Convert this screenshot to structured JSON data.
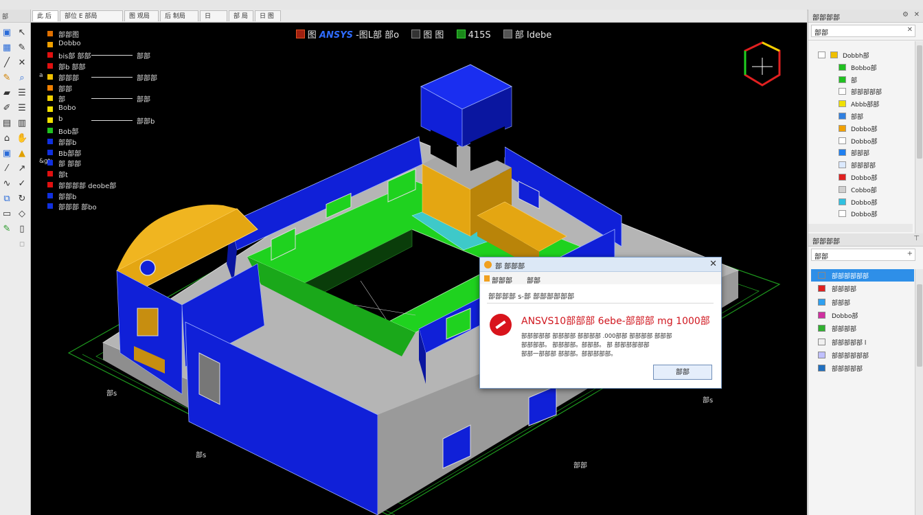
{
  "viewport_tabs": [
    "此 后",
    "部位 E 部局",
    "图 观局",
    "后 制局",
    "日",
    "部 局",
    "日 图"
  ],
  "header": {
    "prefix": "图 ",
    "brand": "ANSYS",
    "title": " -图L部 部o",
    "item1": "图 图",
    "item2": "415S",
    "item3": "部 Idebe"
  },
  "legend": [
    {
      "mark": "",
      "text": "部部图",
      "color": "#e07000"
    },
    {
      "mark": "",
      "text": "Dobbo",
      "color": "#f0a000"
    },
    {
      "mark": "",
      "text": "bis部 部部",
      "color": "#e01010",
      "trail": "部部"
    },
    {
      "mark": "",
      "text": "部b 部部",
      "color": "#e01010"
    },
    {
      "mark": "a",
      "text": "部部部",
      "color": "#f0c000",
      "trail": "部部部"
    },
    {
      "mark": "",
      "text": "部部",
      "color": "#f08000"
    },
    {
      "mark": "",
      "text": "部",
      "color": "#f0d000",
      "trail": "部部"
    },
    {
      "mark": "",
      "text": "Bobo",
      "color": "#f0e000"
    },
    {
      "mark": "",
      "text": "b",
      "color": "#f0e000",
      "trail": "部部b"
    },
    {
      "mark": "",
      "text": "Bob部",
      "color": "#20c020"
    },
    {
      "mark": "",
      "text": "部部b",
      "color": "#1030e0"
    },
    {
      "mark": "",
      "text": "Bb部部",
      "color": "#1030e0"
    },
    {
      "mark": "&gt;",
      "text": "部 部部",
      "color": "#1030e0"
    },
    {
      "mark": "",
      "text": "部t",
      "color": "#e01010"
    },
    {
      "mark": "",
      "text": "部部部部 deobe部",
      "color": "#e01010"
    },
    {
      "mark": "",
      "text": "部部b",
      "color": "#1030e0"
    },
    {
      "mark": "",
      "text": "部部部 部bo",
      "color": "#1030e0"
    }
  ],
  "dims": {
    "a": "部s",
    "b": "部s",
    "c": "部部",
    "d": "部s"
  },
  "dialog": {
    "title": "部 部部部",
    "menu1": "部部部",
    "menu2": "部部",
    "sub": "部部部部 s-部 部部部部部部",
    "heading": "ANSVS10部部部 6ebe-部部部 mg 1000部",
    "body1": "部部部部部 部部部部 部部部部 .000部部 部部部部 部部部",
    "body2": "部部部部。 部部部部。部部部。 部 部部部部部部",
    "body3": "部部一部部部 部部部。部部部部部。",
    "ok": "部部"
  },
  "right_panel": {
    "header1": "部部部部",
    "search1": "部部",
    "tree": [
      {
        "label": "Dobbh部",
        "color": "#f0c000"
      },
      {
        "label": "Bobbo部",
        "color": "#20c020"
      },
      {
        "label": "部",
        "color": "#20c020"
      },
      {
        "label": "部部部部部",
        "color": "#ffffff"
      },
      {
        "label": "Abbb部部",
        "color": "#f0e000"
      },
      {
        "label": "部部",
        "color": "#3080e0"
      },
      {
        "label": "Dobbo部",
        "color": "#f0a000"
      },
      {
        "label": "Dobbo部",
        "color": "#ffffff"
      },
      {
        "label": "部部部",
        "color": "#2080f0"
      },
      {
        "label": "部部部部",
        "color": "#dbe9ff"
      },
      {
        "label": "Dobbo部",
        "color": "#e02020"
      },
      {
        "label": "Cobbo部",
        "color": "#d0d0d0"
      },
      {
        "label": "Dobbo部",
        "color": "#30c0e0"
      },
      {
        "label": "Dobbo部",
        "color": "#ffffff"
      }
    ],
    "header2": "部部部部",
    "search2": "部部",
    "list": [
      {
        "label": "部部部部部部",
        "color": "#2e8fe8",
        "selected": true
      },
      {
        "label": "部部部部",
        "color": "#e02020"
      },
      {
        "label": "部部部",
        "color": "#2fa0f0"
      },
      {
        "label": "Dobbo部",
        "color": "#d030a0"
      },
      {
        "label": "部部部部",
        "color": "#30b030"
      },
      {
        "label": "部部部部部 l",
        "color": "#f0f0f0"
      },
      {
        "label": "部部部部部部",
        "color": "#c0c0ff"
      },
      {
        "label": "部部部部部",
        "color": "#2070c0"
      }
    ]
  }
}
